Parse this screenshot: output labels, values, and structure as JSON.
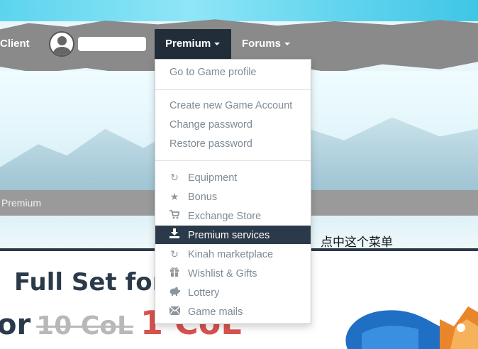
{
  "navbar": {
    "client_label": "Client",
    "premium_label": "Premium",
    "forums_label": "Forums"
  },
  "breadcrumb": {
    "current": "Premium"
  },
  "dropdown": {
    "items": [
      {
        "label": "Go to Game profile",
        "icon": ""
      },
      {
        "label": "Create new Game Account",
        "icon": ""
      },
      {
        "label": "Change password",
        "icon": ""
      },
      {
        "label": "Restore password",
        "icon": ""
      },
      {
        "label": "Equipment",
        "icon": "refresh-icon"
      },
      {
        "label": "Bonus",
        "icon": "star-icon"
      },
      {
        "label": "Exchange Store",
        "icon": "cart-icon"
      },
      {
        "label": "Premium services",
        "icon": "download-icon",
        "active": true
      },
      {
        "label": "Kinah marketplace",
        "icon": "refresh-icon"
      },
      {
        "label": "Wishlist & Gifts",
        "icon": "gift-icon"
      },
      {
        "label": "Lottery",
        "icon": "piggy-bank-icon"
      },
      {
        "label": "Game mails",
        "icon": "envelope-icon"
      }
    ]
  },
  "promo": {
    "headline": "Full Set for",
    "price_prefix": "or",
    "old_price": "10 CoL",
    "new_price": "1 CoL"
  },
  "annotation": "点中这个菜单",
  "colors": {
    "navbar_active": "#222d3a",
    "menu_active": "#2b3a4a",
    "menu_text": "#7d8a95",
    "price_new": "#d9534f"
  }
}
